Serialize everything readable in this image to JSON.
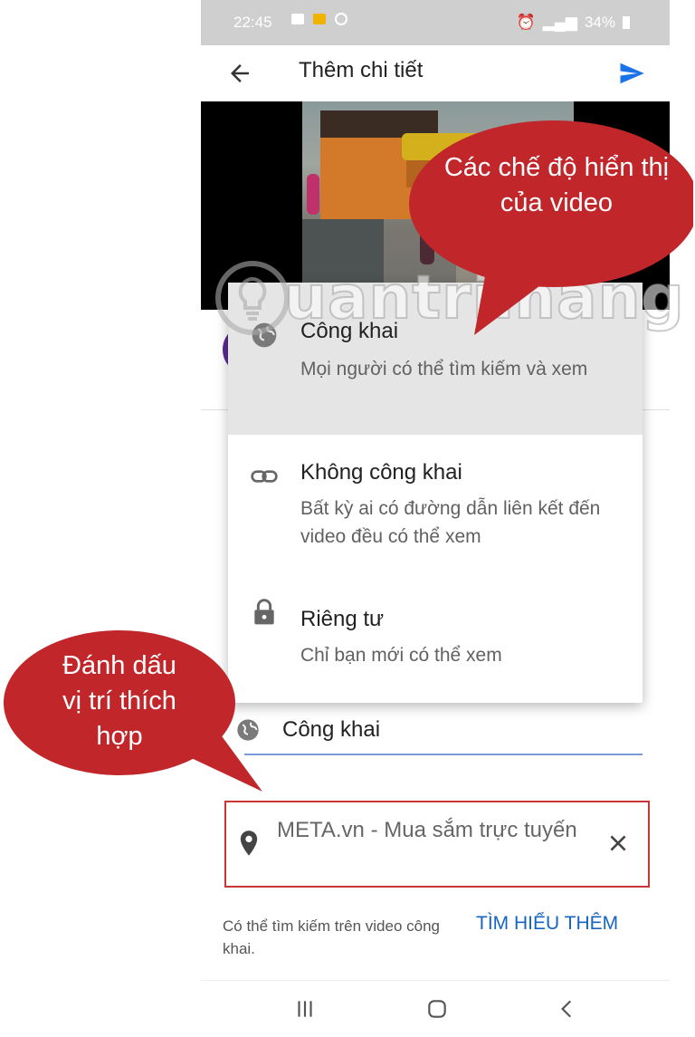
{
  "status_bar": {
    "time": "22:45",
    "battery": "34%"
  },
  "app_bar": {
    "title": "Thêm chi tiết"
  },
  "visibility_menu": {
    "options": [
      {
        "label": "Công khai",
        "description": "Mọi người có thể tìm kiếm và xem",
        "icon": "globe-icon",
        "selected": true
      },
      {
        "label": "Không công khai",
        "description": "Bất kỳ ai có đường dẫn liên kết đến video đều có thể xem",
        "icon": "link-icon",
        "selected": false
      },
      {
        "label": "Riêng tư",
        "description": "Chỉ bạn mới có thể xem",
        "icon": "lock-icon",
        "selected": false
      }
    ]
  },
  "visibility_field": {
    "value": "Công khai"
  },
  "location_field": {
    "value": "META.vn - Mua sắm trực tuyến"
  },
  "footer": {
    "hint": "Có thể tìm kiếm trên video công khai.",
    "learn_more": "TÌM HIỂU THÊM"
  },
  "callouts": {
    "top": "Các chế độ hiển thị của video",
    "left": "Đánh dấu vị trí thích hợp"
  },
  "watermark": "uantrimang",
  "colors": {
    "accent": "#1a73e8",
    "callout": "#c0262a",
    "highlight_border": "#c93636"
  }
}
